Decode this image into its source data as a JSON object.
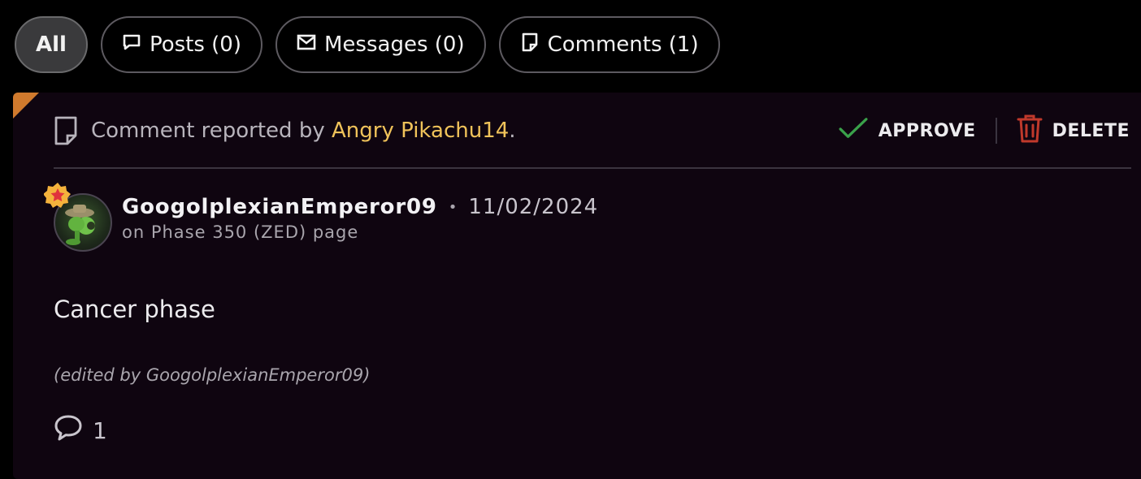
{
  "tabs": [
    {
      "label": "All",
      "icon": null,
      "active": true
    },
    {
      "label": "Posts (0)",
      "icon": "speech-bubble-icon"
    },
    {
      "label": "Messages (0)",
      "icon": "envelope-icon"
    },
    {
      "label": "Comments (1)",
      "icon": "note-icon"
    }
  ],
  "report": {
    "prefix": "Comment reported by ",
    "reporter": "Angry Pikachu14",
    "suffix": ".",
    "approve_label": "APPROVE",
    "delete_label": "DELETE"
  },
  "comment": {
    "username": "GoogolplexianEmperor09",
    "separator": "•",
    "date": "11/02/2024",
    "context": "on Phase 350 (ZED) page",
    "body": "Cancer phase",
    "edited_note": "(edited by GoogolplexianEmperor09)",
    "reply_count": "1"
  },
  "colors": {
    "accent_corner": "#d07a2d",
    "reporter": "#f0c35a",
    "approve_check": "#3aa14a",
    "delete_icon": "#c0392b",
    "card_bg": "#0f0510"
  }
}
